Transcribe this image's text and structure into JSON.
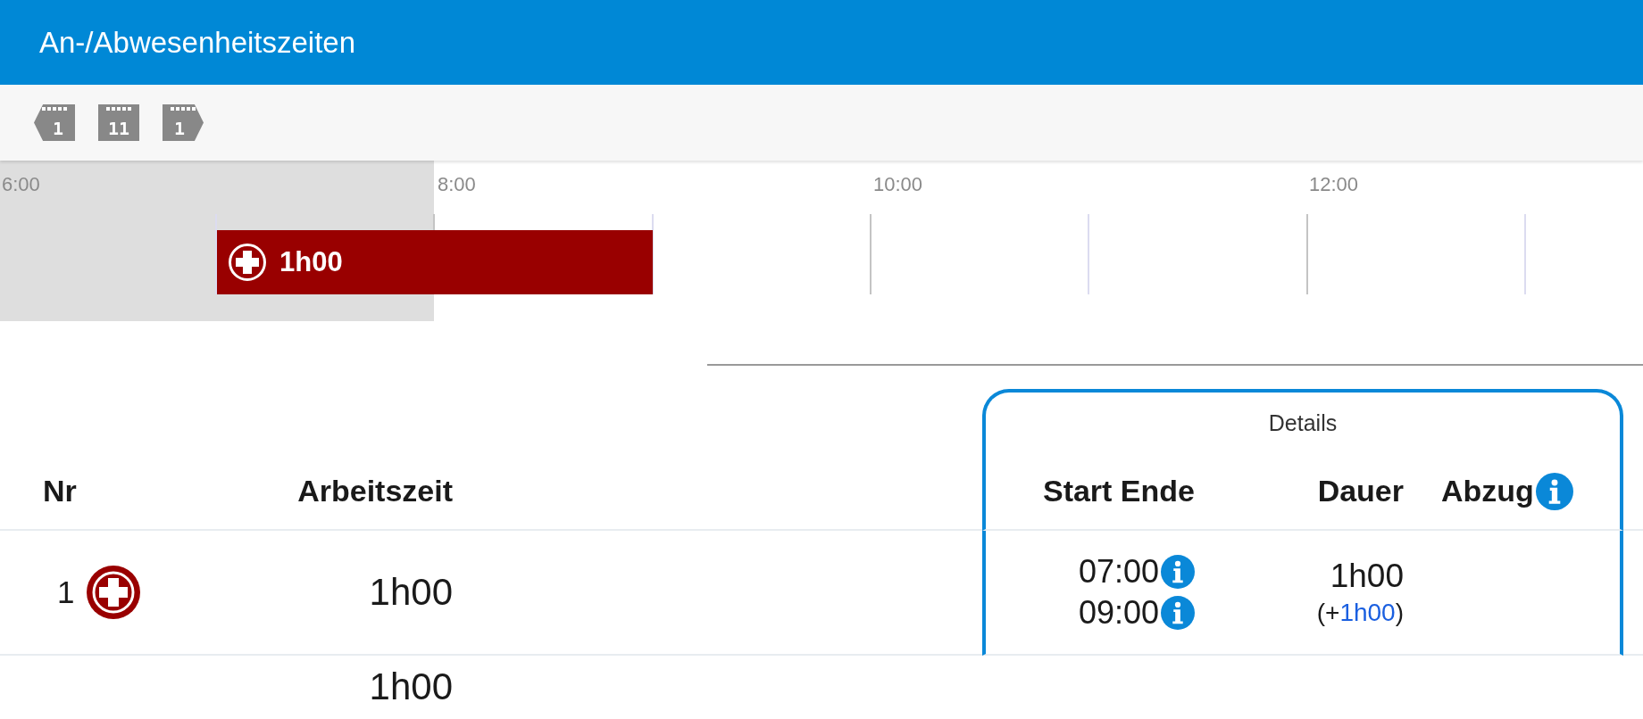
{
  "window": {
    "title": "An-/Abwesenheitszeiten"
  },
  "toolbar": {
    "buttons": [
      {
        "kind": "prev",
        "label": "1"
      },
      {
        "kind": "today",
        "label": "11"
      },
      {
        "kind": "next",
        "label": "1"
      }
    ]
  },
  "timeline": {
    "hour_labels": [
      "6:00",
      "8:00",
      "10:00",
      "12:00"
    ],
    "entries": [
      {
        "kind": "sick",
        "label": "1h00"
      }
    ]
  },
  "table": {
    "details_title": "Details",
    "columns": {
      "nr": "Nr",
      "work_time": "Arbeitszeit",
      "start_end": "Start Ende",
      "duration": "Dauer",
      "deduction": "Abzug"
    },
    "rows": [
      {
        "nr": "1",
        "kind": "sick",
        "work_time": "1h00",
        "start": "07:00",
        "end": "09:00",
        "duration": "1h00",
        "extra": {
          "open": "(+",
          "value": "1h00",
          "close": ")"
        }
      }
    ],
    "total": {
      "work_time": "1h00"
    }
  }
}
